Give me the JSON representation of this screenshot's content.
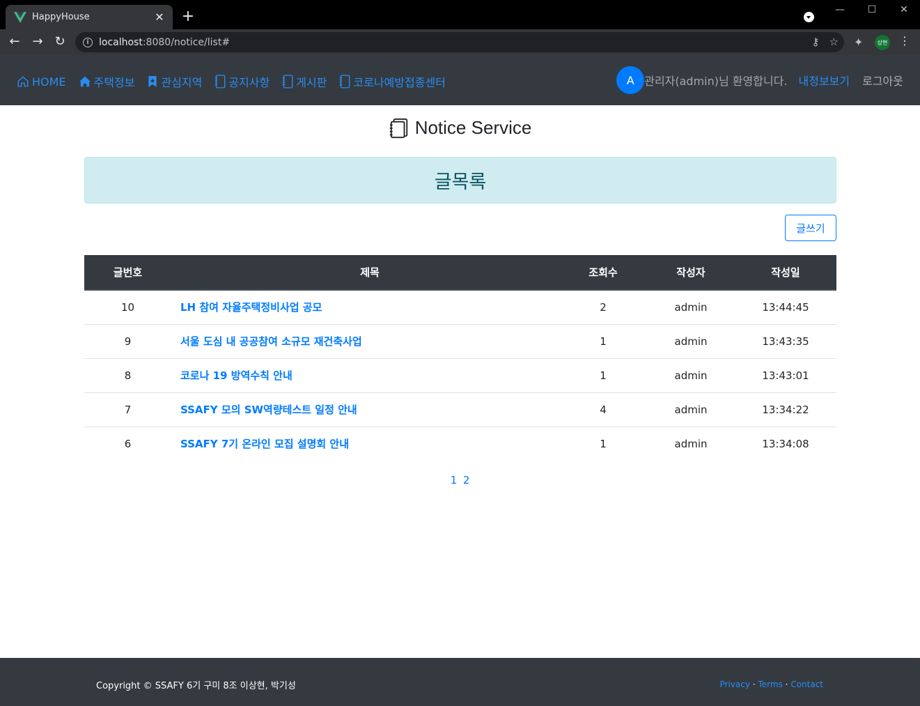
{
  "browser": {
    "tab_title": "HappyHouse",
    "tab_close": "✕",
    "new_tab": "+",
    "url_host": "localhost",
    "url_path": ":8080/notice/list#",
    "profile_label": "상현",
    "window_minimize": "—",
    "window_maximize": "☐",
    "window_close": "✕"
  },
  "nav": {
    "items": [
      {
        "label": "HOME",
        "icon": "house-icon"
      },
      {
        "label": "주택정보",
        "icon": "house-fill-icon"
      },
      {
        "label": "관심지역",
        "icon": "bookmark-icon"
      },
      {
        "label": "공지사항",
        "icon": "journal-icon"
      },
      {
        "label": "게시판",
        "icon": "journal-icon"
      },
      {
        "label": "코로나예방접종센터",
        "icon": "journal-icon"
      }
    ],
    "avatar_letter": "A",
    "welcome": "관리자(admin)님 환영합니다.",
    "mypage": "내정보보기",
    "logout": "로그아웃",
    "accent": "#2a8cf3"
  },
  "page": {
    "heading": "Notice Service",
    "list_title": "글목록",
    "write_button": "글쓰기"
  },
  "table": {
    "headers": [
      "글번호",
      "제목",
      "조회수",
      "작성자",
      "작성일"
    ],
    "rows": [
      {
        "no": "10",
        "title": "LH 참여 자율주택정비사업 공모",
        "hit": "2",
        "writer": "admin",
        "date": "13:44:45"
      },
      {
        "no": "9",
        "title": "서울 도심 내 공공참여 소규모 재건축사업",
        "hit": "1",
        "writer": "admin",
        "date": "13:43:35"
      },
      {
        "no": "8",
        "title": "코로나 19 방역수칙 안내",
        "hit": "1",
        "writer": "admin",
        "date": "13:43:01"
      },
      {
        "no": "7",
        "title": "SSAFY 모의 SW역량테스트 일정 안내",
        "hit": "4",
        "writer": "admin",
        "date": "13:34:22"
      },
      {
        "no": "6",
        "title": "SSAFY 7기 온라인 모집 설명회 안내",
        "hit": "1",
        "writer": "admin",
        "date": "13:34:08"
      }
    ]
  },
  "pagination": {
    "pages": [
      "1",
      "2"
    ]
  },
  "footer": {
    "copyright": "Copyright © SSAFY 6기 구미 8조 이상현, 박기성",
    "links": [
      "Privacy",
      "Terms",
      "Contact"
    ],
    "separator": "·"
  }
}
